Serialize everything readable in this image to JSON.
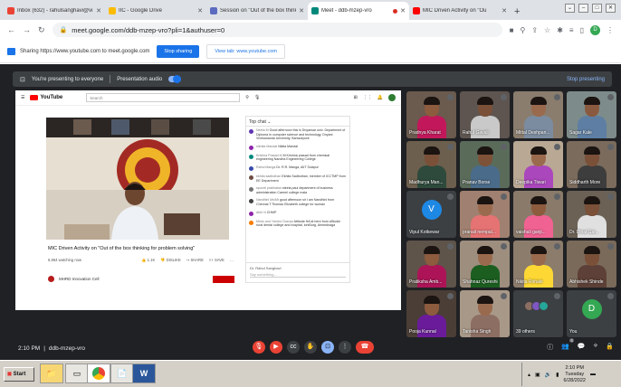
{
  "browser": {
    "tabs": [
      {
        "title": "Inbox (632) - rahulsanghavi@vi",
        "color": "#ea4335",
        "active": false
      },
      {
        "title": "IIC - Google Drive",
        "color": "#fbbc04",
        "active": false
      },
      {
        "title": "Session on \"Out of the box thinki",
        "color": "#5c6bc0",
        "active": false
      },
      {
        "title": "Meet - ddb-mzep-vro",
        "color": "#00897b",
        "active": true
      },
      {
        "title": "MIC Driven Activity on \"Ou",
        "color": "#ff0000",
        "active": false
      }
    ],
    "new_tab": "+",
    "url": "meet.google.com/ddb-mzep-vro?pli=1&authuser=0",
    "profile_letter": "D"
  },
  "share_bar": {
    "text": "Sharing https://www.youtube.com to meet.google.com",
    "stop_label": "Stop sharing",
    "view_label": "View tab: www.youtube.com"
  },
  "meet": {
    "presenting_text": "You're presenting to everyone",
    "audio_label": "Presentation audio",
    "stop_presenting": "Stop presenting",
    "time": "2:10 PM",
    "separator": "|",
    "meeting_code": "ddb-mzep-vro",
    "participant_count": "6",
    "participants": [
      {
        "name": "Pradnya Kharat",
        "bg": "#6b5a4e",
        "shirt": "#c2185b",
        "skin": "#8d5b3e"
      },
      {
        "name": "Rahul Gavali",
        "bg": "#5e5550",
        "shirt": "#c9c9c9",
        "skin": "#7a5038"
      },
      {
        "name": "Mittal Deshpan...",
        "bg": "#8a7d6e",
        "shirt": "#7b8ca0",
        "skin": "#9a6a4e"
      },
      {
        "name": "Sagar Kale",
        "bg": "#7d8c8a",
        "shirt": "#5e7fa3",
        "skin": "#8a5a40"
      },
      {
        "name": "Madhurya Man...",
        "bg": "#6d5f4d",
        "shirt": "#2e4a3c",
        "skin": "#7a5038"
      },
      {
        "name": "Pranav Borse",
        "bg": "#5a6b5a",
        "shirt": "#4a6b8a",
        "skin": "#7e5238"
      },
      {
        "name": "Deepika Tiwari",
        "bg": "#b9a894",
        "shirt": "#ab47bc",
        "skin": "#9a6a4e"
      },
      {
        "name": "Siddharth More",
        "bg": "#7b6b5c",
        "shirt": "#3d3d3d",
        "skin": "#7a5038"
      },
      {
        "name": "Vipul Kotkewar",
        "bg": "#3c4043",
        "letter": "V",
        "letter_bg": "#1e88e5"
      },
      {
        "name": "pranali nempal...",
        "bg": "#a08070",
        "shirt": "#e57373",
        "skin": "#9a6a4e"
      },
      {
        "name": "vaishali ganji...",
        "bg": "#8a7a6a",
        "shirt": "#f06292",
        "skin": "#8d5b3e"
      },
      {
        "name": "Dr. Dinal Gar...",
        "bg": "#6b6155",
        "shirt": "#e0e0e0",
        "skin": "#7a5038"
      },
      {
        "name": "Pratiksha Amb...",
        "bg": "#5e544a",
        "shirt": "#ad1457",
        "skin": "#8d5b3e"
      },
      {
        "name": "Shahnaz Qureshi",
        "bg": "#9e8e7e",
        "shirt": "#1b5e20",
        "skin": "#9a6a4e"
      },
      {
        "name": "Nikita Rohale",
        "bg": "#8c7c6c",
        "shirt": "#fdd835",
        "skin": "#9a6a4e"
      },
      {
        "name": "Abhishek Shinde",
        "bg": "#7a6a5a",
        "shirt": "#5d4037",
        "skin": "#7a5038"
      },
      {
        "name": "Pooja Kunnal",
        "bg": "#4a3e36",
        "shirt": "#6a1b9a",
        "skin": "#8d5b3e"
      },
      {
        "name": "Tanisha Singh",
        "bg": "#a89888",
        "shirt": "#8d6e63",
        "skin": "#9a6a4e"
      },
      {
        "name": "39 others",
        "bg": "#3c4043"
      },
      {
        "name": "You",
        "bg": "#3c4043",
        "letter": "D",
        "letter_bg": "#34a853"
      }
    ]
  },
  "youtube": {
    "logo": "YouTube",
    "search_placeholder": "Search",
    "video_title": "MIC Driven Activity on \"Out of the box thinking for problem solving\"",
    "watching": "6,964 watching now",
    "likes": "1.1K",
    "dislike": "DISLIKE",
    "share": "SHARE",
    "save": "SAVE",
    "channel": "MHRD Innovation Cell",
    "chat_title": "Top chat",
    "chat_input": "Say something...",
    "chat_user": "Dr. Rahul Sanghavi",
    "chat": [
      {
        "name": "Neeta M",
        "text": "Good afternoon this is Dnyansar univ. Department of Diploma in computer science and technology, Dnyani Vivekananda University, Barrackpore",
        "color": "#5e35b1"
      },
      {
        "name": "nikhita Mandal",
        "text": "Nikita Mandal",
        "color": "#8e24aa"
      },
      {
        "name": "Krishna Prasad M",
        "text": "M Krishna prasad from chemical engineering Nandha Engineering College",
        "color": "#00897b"
      },
      {
        "name": "Rahul Manga",
        "text": "Dr. R.R. Manga, AIIT Solapur",
        "color": "#3949ab"
      },
      {
        "name": "ekhita sadbuthan",
        "text": "Ekhita Sadbuthan, member of ICCTMP from EE Department",
        "color": "#6d4c41"
      },
      {
        "name": "spoorti prabhakar",
        "text": "steela paul department of business administration Carmel college mala",
        "color": "#757575"
      },
      {
        "name": "Nandhini Ms/Mt",
        "text": "good afternoon sir I am Nandhini from Chennai T.Thomas Elizabeth college for woman",
        "color": "#424242"
      },
      {
        "name": "Abhi N",
        "text": "CHMP",
        "color": "#8e24aa"
      },
      {
        "name": "Mintu and Yamini Chavan",
        "text": "Attitude fell at here from aStudie rural dental college and hospital, loniBurg, Ahmednaga",
        "color": "#f57c00"
      }
    ]
  },
  "taskbar": {
    "start": "Start",
    "time": "2:10 PM",
    "day": "Tuesday",
    "date": "6/28/2022"
  }
}
